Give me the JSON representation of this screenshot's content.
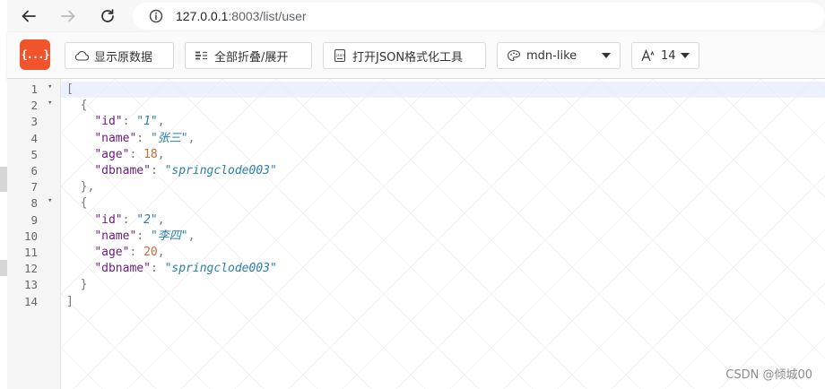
{
  "browser": {
    "url_host": "127.0.0.1",
    "url_rest": ":8003/list/user"
  },
  "toolbar": {
    "raw_label": "显示原数据",
    "fold_label": "全部折叠/展开",
    "json_tool_label": "打开JSON格式化工具",
    "theme_value": "mdn-like",
    "font_size_value": "14",
    "logo_text": "{...}"
  },
  "editor": {
    "lines": [
      {
        "num": "1",
        "fold": true
      },
      {
        "num": "2",
        "fold": true
      },
      {
        "num": "3",
        "fold": false
      },
      {
        "num": "4",
        "fold": false
      },
      {
        "num": "5",
        "fold": false
      },
      {
        "num": "6",
        "fold": false
      },
      {
        "num": "7",
        "fold": false
      },
      {
        "num": "8",
        "fold": true
      },
      {
        "num": "9",
        "fold": false
      },
      {
        "num": "10",
        "fold": false
      },
      {
        "num": "11",
        "fold": false
      },
      {
        "num": "12",
        "fold": false
      },
      {
        "num": "13",
        "fold": false
      },
      {
        "num": "14",
        "fold": false
      }
    ],
    "users": [
      {
        "id": "1",
        "name": "张三",
        "age": "18",
        "dbname": "springclode003"
      },
      {
        "id": "2",
        "name": "李四",
        "age": "20",
        "dbname": "springclode003"
      }
    ],
    "keys": {
      "id": "\"id\"",
      "name": "\"name\"",
      "age": "\"age\"",
      "dbname": "\"dbname\""
    }
  },
  "watermark": "CSDN @倾城00",
  "colors": {
    "logo": "#f1542a",
    "key": "#6a1b7a",
    "string": "#2a7fa8",
    "number": "#c76b3a"
  }
}
